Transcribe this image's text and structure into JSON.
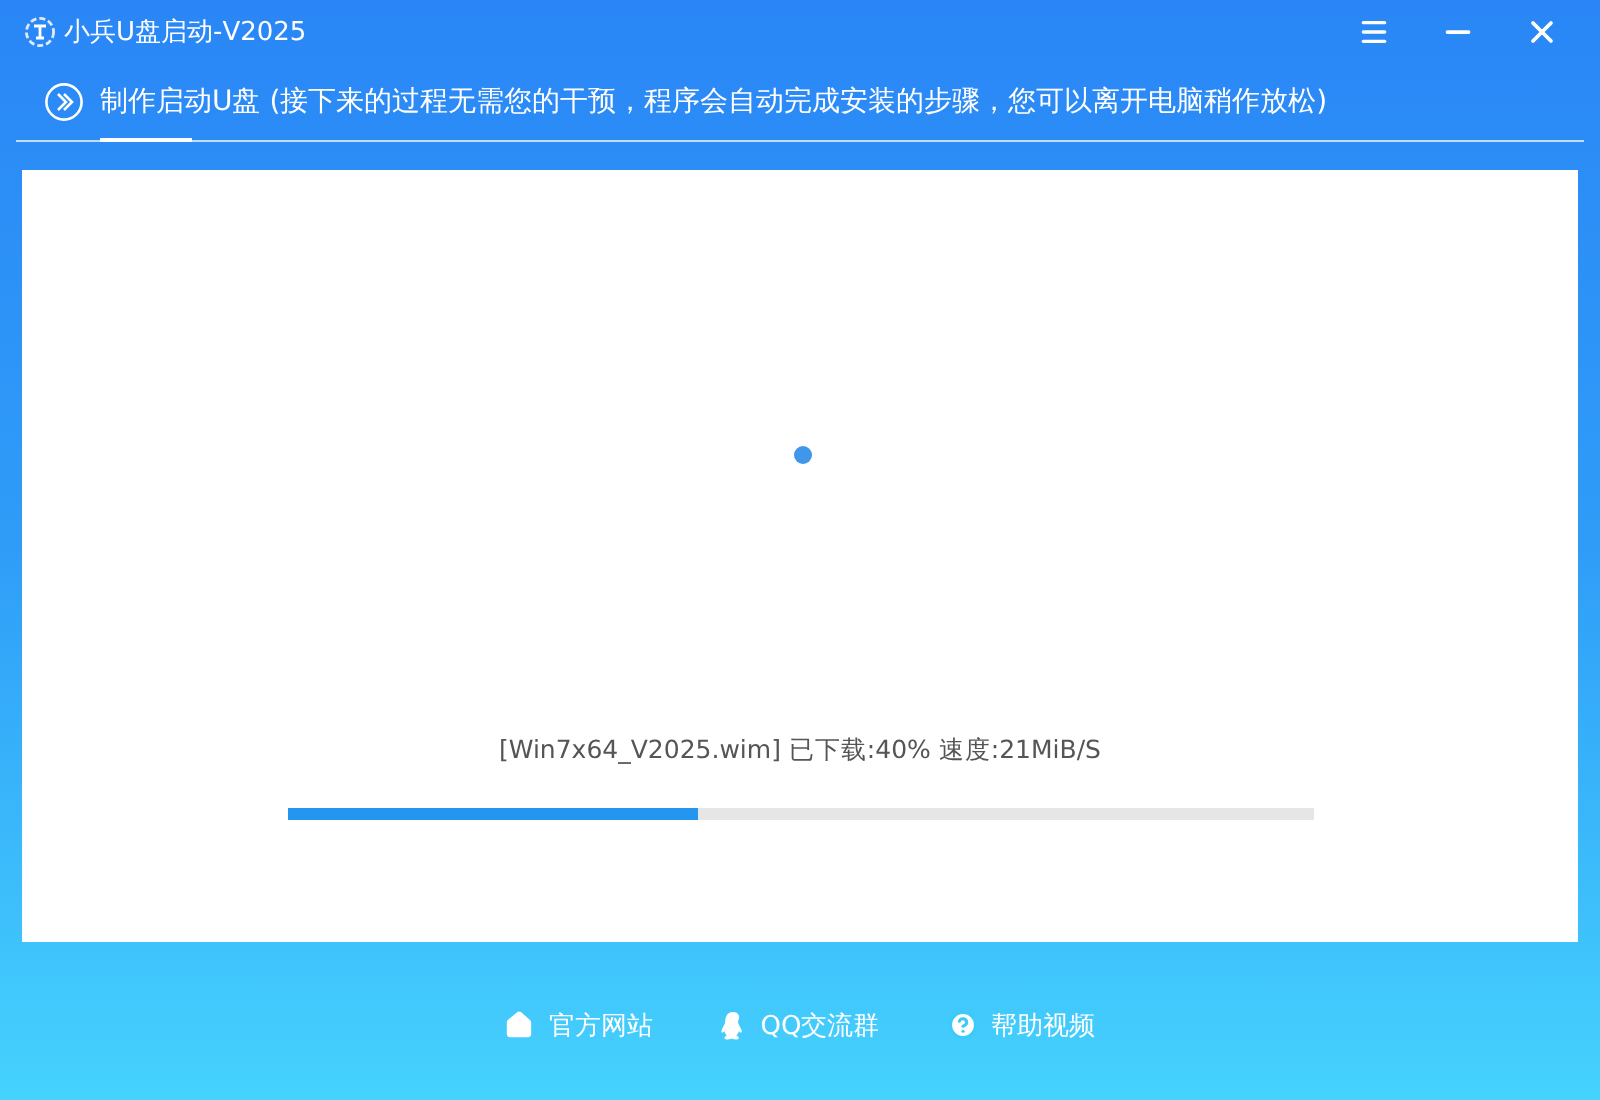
{
  "window": {
    "title": "小兵U盘启动-V2025"
  },
  "tabs": [
    {
      "label": "制作启动U盘 (接下来的过程无需您的干预，程序会自动完成安装的步骤，您可以离开电脑稍作放松)",
      "selected": true
    }
  ],
  "progress": {
    "status": "[Win7x64_V2025.wim] 已下载:40% 速度:21MiB/S",
    "level": 0.4
  },
  "footer_links": [
    {
      "kind": "home",
      "label": "官方网站"
    },
    {
      "kind": "qq",
      "label": "QQ交流群"
    },
    {
      "kind": "help",
      "label": "帮助视频"
    }
  ]
}
